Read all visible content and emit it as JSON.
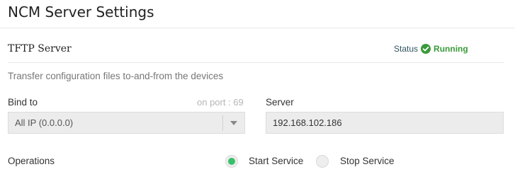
{
  "page": {
    "title": "NCM Server Settings"
  },
  "tftp": {
    "section_title": "TFTP Server",
    "status_label": "Status",
    "status_value": "Running",
    "status_color": "#3a9a3a",
    "status_icon": "check-circle-icon",
    "description": "Transfer configuration files to-and-from the devices"
  },
  "bind": {
    "label": "Bind to",
    "port_text": "on port : 69",
    "selected": "All IP (0.0.0.0)",
    "caret_icon": "caret-down-icon"
  },
  "server": {
    "label": "Server",
    "value": "192.168.102.186"
  },
  "operations": {
    "label": "Operations",
    "options": [
      {
        "label": "Start Service",
        "selected": true
      },
      {
        "label": "Stop Service",
        "selected": false
      }
    ],
    "accent_color": "#3bbf6a"
  }
}
